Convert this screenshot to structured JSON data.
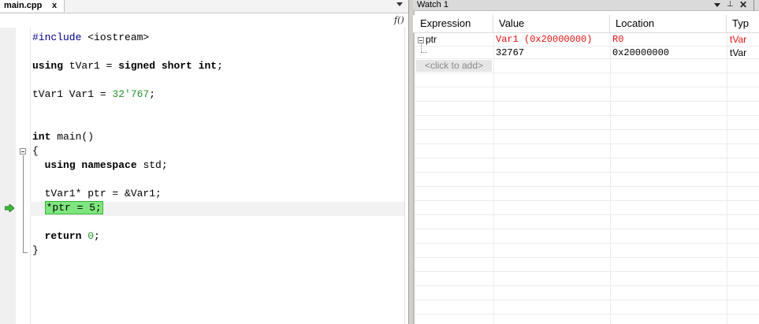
{
  "editor": {
    "tab_label": "main.cpp",
    "tab_close": "x",
    "func_icon": "f()",
    "lines": {
      "l1_a": "#include",
      "l1_b": " <iostream>",
      "l3_a": "using",
      "l3_b": " tVar1 = ",
      "l3_c": "signed short int",
      "l3_d": ";",
      "l5_a": "tVar1 Var1 = ",
      "l5_b": "32'767",
      "l5_c": ";",
      "l8_a": "int",
      "l8_b": " main()",
      "l9": "{",
      "l10_a": "  ",
      "l10_b": "using namespace",
      "l10_c": " std;",
      "l12": "  tVar1* ptr = &Var1;",
      "l13_a": "  ",
      "l13_b": "*ptr = 5;",
      "l15_a": "  ",
      "l15_b": "return",
      "l15_c": " ",
      "l15_d": "0",
      "l15_e": ";",
      "l16": "}"
    }
  },
  "watch": {
    "title": "Watch 1",
    "pin": "⊥",
    "close": "✕",
    "columns": [
      "Expression",
      "Value",
      "Location",
      "Typ"
    ],
    "rows": [
      {
        "expression": "ptr",
        "value": "Var1 (0x20000000)",
        "location": "R0",
        "type": "tVar"
      },
      {
        "expression": "",
        "value": "32767",
        "location": "0x20000000",
        "type": "tVar"
      }
    ],
    "click_to_add": "<click to add>"
  },
  "colors": {
    "highlight": "#7fe67f",
    "changed_value": "#e01010",
    "number_literal": "#2a8f2a"
  }
}
